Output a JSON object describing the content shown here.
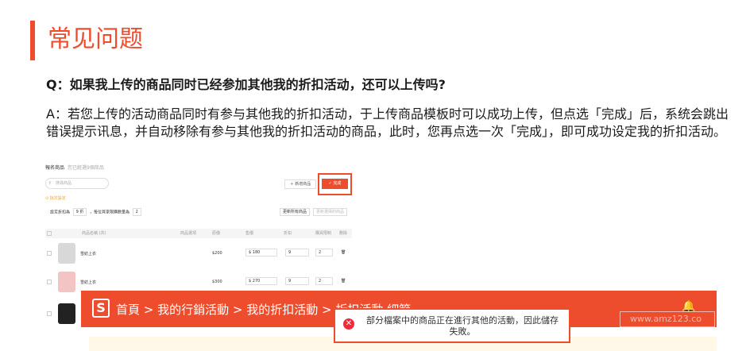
{
  "section_title": "常见问题",
  "question": "Q：如果我上传的商品同时已经参加其他我的折扣活动，还可以上传吗?",
  "answer": "A：若您上传的活动商品同时有参与其他我的折扣活动，于上传商品模板时可以成功上传，但点选「完成」后，系统会跳出错误提示讯息，并自动移除有参与其他我的折扣活动的商品，此时，您再点选一次「完成」，即可成功设定我的折扣活动。",
  "colors": {
    "accent": "#ee4d2d",
    "error": "#ee2c3c",
    "warning": "#f0a020"
  },
  "screenshot": {
    "header": "報名商品",
    "header_sub": "您已經選9個商品",
    "search_placeholder": "搜尋商品",
    "add_button": "新增商品",
    "done_button": "完成",
    "warning_text": "批次設定",
    "set_discount_label": "設定折扣為",
    "discount_value": "9",
    "discount_unit": "折",
    "limit_label": "，每位買家限購數量為",
    "limit_value": "2",
    "update_all": "更新所有商品",
    "update_selected": "更新選擇的商品",
    "columns": [
      "商品名稱 (共)",
      "商品選項",
      "原價",
      "售價",
      "折扣",
      "購買限制",
      "刪除"
    ],
    "rows": [
      {
        "name": "雪紡上衣",
        "price": "$200",
        "sale": "$ 180",
        "discount": "9",
        "limit": "2"
      },
      {
        "name": "雪紡上衣",
        "price": "$300",
        "sale": "$ 270",
        "discount": "9",
        "limit": "2"
      }
    ]
  },
  "banner": {
    "logo": "S",
    "breadcrumb": "首頁 > 我的行銷活動 > 我的折扣活動 > 折扣活動 細節",
    "watermark": "www.amz123.co"
  },
  "error_message": "部分檔案中的商品正在進行其他的活動，因此儲存失敗。"
}
